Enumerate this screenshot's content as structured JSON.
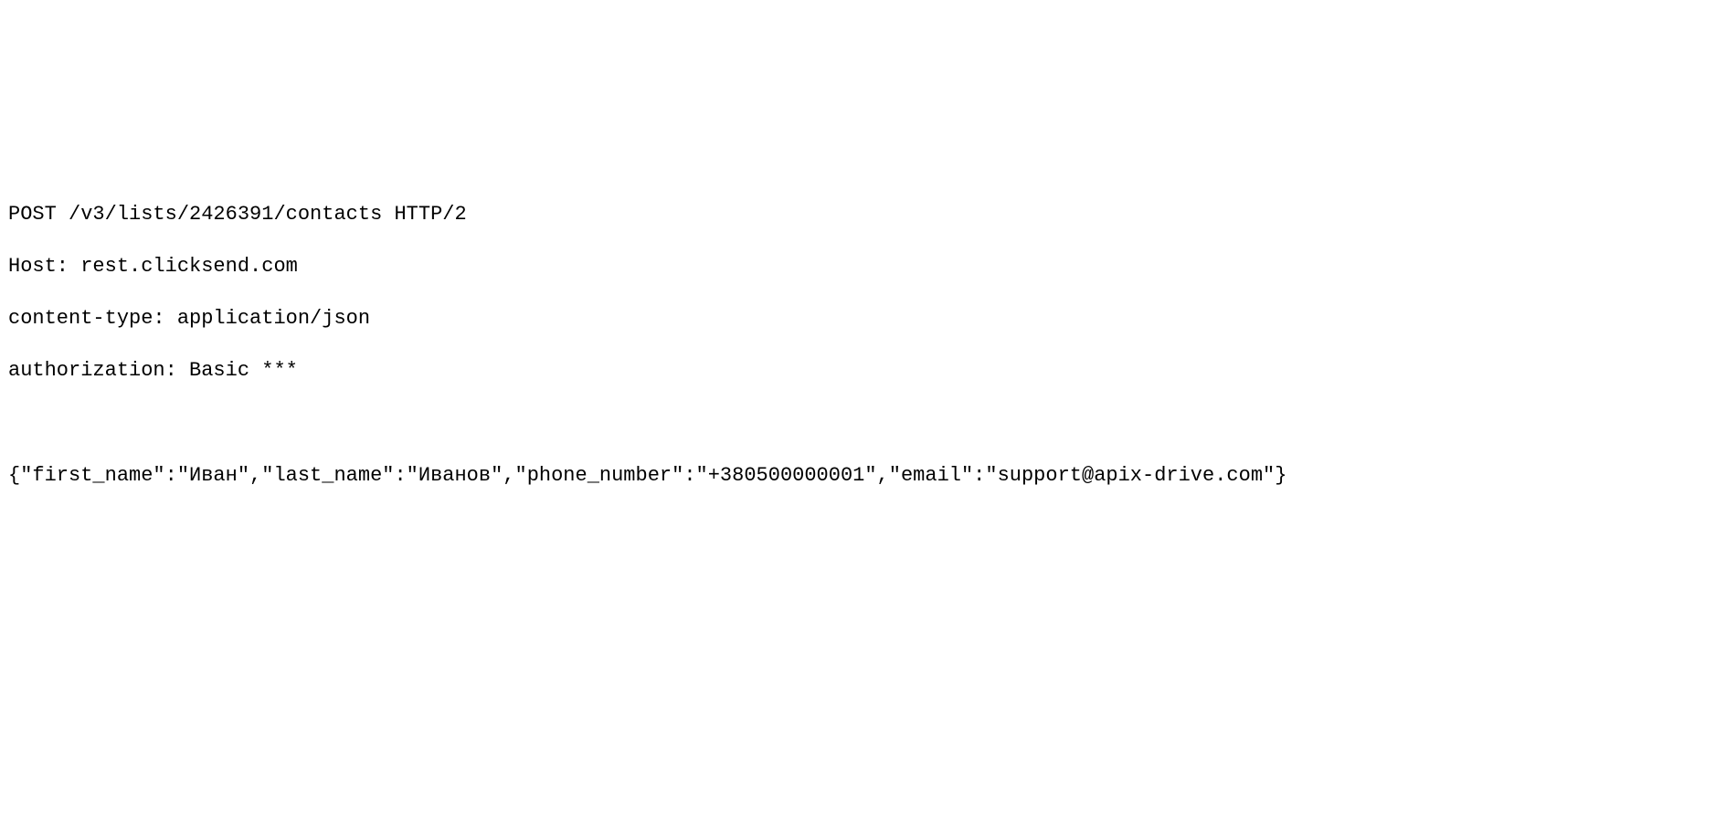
{
  "http_request": {
    "request_line": "POST /v3/lists/2426391/contacts HTTP/2",
    "headers": {
      "host": "Host: rest.clicksend.com",
      "content_type": "content-type: application/json",
      "authorization": "authorization: Basic ***"
    },
    "body": "{\"first_name\":\"Иван\",\"last_name\":\"Иванов\",\"phone_number\":\"+380500000001\",\"email\":\"support@apix-drive.com\"}"
  }
}
